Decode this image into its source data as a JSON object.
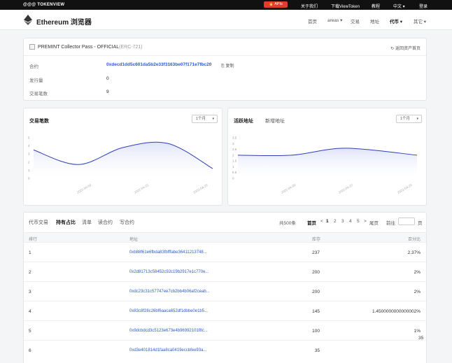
{
  "topbar": {
    "brand": "@@@ TOKENVIEW",
    "apis": "APIs",
    "links": [
      "关于我们",
      "下载ViewToken",
      "教程",
      "中文 ▾",
      "登录"
    ]
  },
  "navbar": {
    "title": "Ethereum 浏览器",
    "items": [
      {
        "label": "首页",
        "active": false
      },
      {
        "label": "areas ▾",
        "active": false
      },
      {
        "label": "交易",
        "active": false
      },
      {
        "label": "地址",
        "active": false
      },
      {
        "label": "代币 ▾",
        "active": true
      },
      {
        "label": "其它 ▾",
        "active": false
      }
    ]
  },
  "token": {
    "name": "PREMINT Collector Pass - OFFICIAL",
    "standard": "(ERC-721)",
    "back": "返回资产首页",
    "contract_label": "合约",
    "contract_value": "0xdecd1dd5c601da5b2e33f3163be07f171e7fbc20",
    "copy_label": "复制",
    "supply_label": "发行量",
    "supply_value": "0",
    "tx_label": "交易笔数",
    "tx_value": "9"
  },
  "charts": {
    "left": {
      "title": "交易笔数",
      "range": "1个月"
    },
    "right": {
      "title": "活跃地址",
      "subtab": "新增地址",
      "range": "1个月"
    }
  },
  "chart_data": [
    {
      "type": "area",
      "title": "交易笔数",
      "y_ticks": [
        0,
        1,
        2,
        3,
        4,
        5
      ],
      "ylim": [
        0,
        5
      ],
      "x_ticks": [
        "2022-04-09",
        "2022-04-22",
        "2022-04-25"
      ],
      "x": [
        0,
        0.25,
        0.5,
        0.75,
        1
      ],
      "values": [
        3.5,
        1.7,
        3.8,
        4.3,
        1.2
      ],
      "grid": false
    },
    {
      "type": "area",
      "title": "活跃地址",
      "y_ticks": [
        0,
        0.5,
        1,
        1.5,
        2,
        2.5,
        3,
        3.5
      ],
      "ylim": [
        0,
        3.5
      ],
      "x_ticks": [
        "2022-04-09",
        "2022-04-22",
        "2022-04-25"
      ],
      "x": [
        0,
        0.3,
        0.6,
        1
      ],
      "values": [
        2.0,
        2.0,
        2.6,
        2.0
      ],
      "grid": false
    }
  ],
  "table": {
    "tabs": [
      {
        "label": "代币交易",
        "active": false
      },
      {
        "label": "持有占比",
        "active": true
      },
      {
        "label": "清单",
        "active": false
      },
      {
        "label": "读合约",
        "active": false
      },
      {
        "label": "写合约",
        "active": false
      }
    ],
    "total": "共500条",
    "first": "首页",
    "prev": "<",
    "pages": [
      "1",
      "2",
      "3",
      "4",
      "5"
    ],
    "next": ">",
    "last": "尾页",
    "goto": "前往",
    "page_unit": "页",
    "headers": {
      "rank": "排行",
      "address": "地址",
      "stock": "库存",
      "percent": "百分比"
    },
    "rows": [
      {
        "rank": "1",
        "address": "0xb88f61e6fbda83fbfffabe36411213748...",
        "stock": "237",
        "percent": "2.37%"
      },
      {
        "rank": "2",
        "address": "0x2d81713c58452c92c19b2917e1c770e...",
        "stock": "200",
        "percent": "2%"
      },
      {
        "rank": "3",
        "address": "0xdc23c31c57747ee7cb2bb4b06af2ceab...",
        "stock": "200",
        "percent": "2%"
      },
      {
        "rank": "4",
        "address": "0x83c8f28c26bf6aaca652df1dbbe0e1b5...",
        "stock": "145",
        "percent": "1.4500000000000002%"
      },
      {
        "rank": "5",
        "address": "0x9dcbdcd3c5123e673e4b96992101f8c...",
        "stock": "100",
        "percent": "1%"
      },
      {
        "rank": "6",
        "address": "0xd3e401814d1faa8ca0419eccbfee93a...",
        "stock": "35",
        "percent": ""
      }
    ],
    "overflow_value": "35"
  },
  "colors": {
    "accent": "#2a5ad7",
    "line": "#2f3fb5",
    "fill": "#dfe3f7",
    "topbar": "#111111",
    "apis": "#e03e2d"
  }
}
